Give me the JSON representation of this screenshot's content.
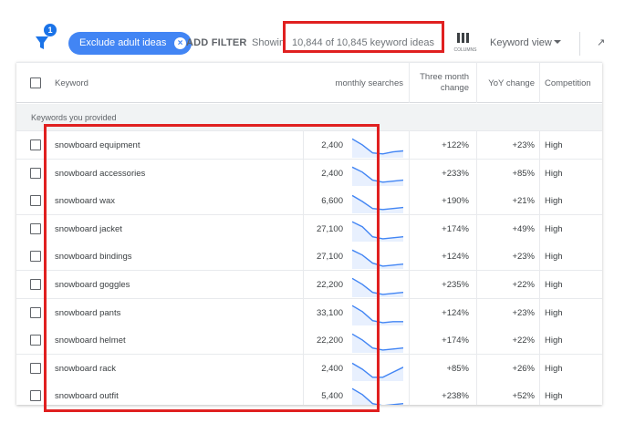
{
  "toolbar": {
    "filter_badge": "1",
    "exclude_chip_label": "Exclude adult ideas",
    "add_filter_label": "ADD FILTER",
    "showing_label": "Showin",
    "idea_count_text": "10,844 of 10,845 keyword ideas",
    "columns_label": "COLUMNS",
    "keyword_view_label": "Keyword view",
    "more_label": "↗"
  },
  "table": {
    "columns": {
      "keyword": "Keyword",
      "monthly_searches": "monthly searches",
      "three_month_change": "Three month change",
      "yoy_change": "YoY change",
      "competition": "Competition"
    },
    "group_label": "Keywords you provided",
    "rows": [
      {
        "keyword": "snowboard equipment",
        "searches": "2,400",
        "three_month": "+122%",
        "yoy": "+23%",
        "competition": "High",
        "trend": [
          3,
          9,
          17,
          18,
          16,
          15
        ]
      },
      {
        "keyword": "snowboard accessories",
        "searches": "2,400",
        "three_month": "+233%",
        "yoy": "+85%",
        "competition": "High",
        "trend": [
          3,
          8,
          16,
          18,
          17,
          16
        ]
      },
      {
        "keyword": "snowboard wax",
        "searches": "6,600",
        "three_month": "+190%",
        "yoy": "+21%",
        "competition": "High",
        "trend": [
          4,
          10,
          17,
          18,
          17,
          16
        ]
      },
      {
        "keyword": "snowboard jacket",
        "searches": "27,100",
        "three_month": "+174%",
        "yoy": "+49%",
        "competition": "High",
        "trend": [
          2,
          7,
          17,
          19,
          18,
          17
        ]
      },
      {
        "keyword": "snowboard bindings",
        "searches": "27,100",
        "three_month": "+124%",
        "yoy": "+23%",
        "competition": "High",
        "trend": [
          3,
          8,
          16,
          19,
          18,
          17
        ]
      },
      {
        "keyword": "snowboard goggles",
        "searches": "22,200",
        "three_month": "+235%",
        "yoy": "+22%",
        "competition": "High",
        "trend": [
          3,
          9,
          17,
          19,
          18,
          17
        ]
      },
      {
        "keyword": "snowboard pants",
        "searches": "33,100",
        "three_month": "+124%",
        "yoy": "+23%",
        "competition": "High",
        "trend": [
          2,
          8,
          17,
          19,
          18,
          18
        ]
      },
      {
        "keyword": "snowboard helmet",
        "searches": "22,200",
        "three_month": "+174%",
        "yoy": "+22%",
        "competition": "High",
        "trend": [
          3,
          9,
          17,
          19,
          18,
          17
        ]
      },
      {
        "keyword": "snowboard rack",
        "searches": "2,400",
        "three_month": "+85%",
        "yoy": "+26%",
        "competition": "High",
        "trend": [
          4,
          10,
          18,
          18,
          13,
          8
        ]
      },
      {
        "keyword": "snowboard outfit",
        "searches": "5,400",
        "three_month": "+238%",
        "yoy": "+52%",
        "competition": "High",
        "trend": [
          2,
          8,
          17,
          19,
          18,
          17
        ]
      }
    ]
  },
  "colors": {
    "chip": "#4285f4",
    "trend_line": "#4285f4",
    "trend_fill": "#e8f0fe",
    "highlight": "#e02020"
  }
}
